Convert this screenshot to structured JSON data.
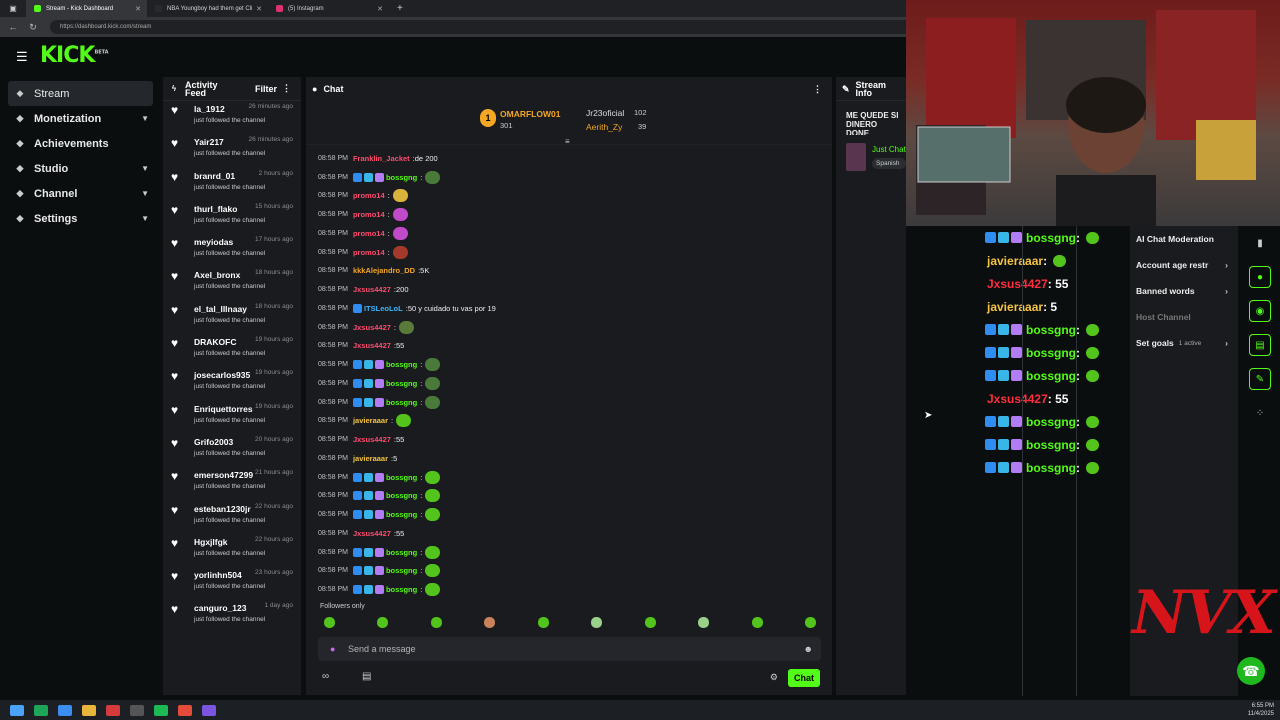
{
  "browser": {
    "tabs": [
      {
        "label": "Stream - Kick Dashboard",
        "color": "#53fc18"
      },
      {
        "label": "NBA Youngboy had them get Cli",
        "color": "#2a2a2a"
      },
      {
        "label": "(5) Instagram",
        "color": "#e1306c"
      }
    ],
    "url": "https://dashboard.kick.com/stream"
  },
  "brand": {
    "logo": "KICK",
    "beta": "BETA"
  },
  "sidebar": {
    "items": [
      {
        "label": "Stream",
        "icon": "stream-icon",
        "chev": ""
      },
      {
        "label": "Monetization",
        "icon": "dollar-icon",
        "chev": "▼"
      },
      {
        "label": "Achievements",
        "icon": "trophy-icon",
        "chev": ""
      },
      {
        "label": "Studio",
        "icon": "studio-icon",
        "chev": "▼"
      },
      {
        "label": "Channel",
        "icon": "channel-icon",
        "chev": "▼"
      },
      {
        "label": "Settings",
        "icon": "gear-icon",
        "chev": "▼"
      }
    ]
  },
  "activity": {
    "title": "Activity Feed",
    "filter": "Filter",
    "items": [
      {
        "name": "la_1912",
        "ago": "26 minutes ago",
        "text": "just followed the channel"
      },
      {
        "name": "Yair217",
        "ago": "26 minutes ago",
        "text": "just followed the channel"
      },
      {
        "name": "branrd_01",
        "ago": "2 hours ago",
        "text": "just followed the channel"
      },
      {
        "name": "thurl_flako",
        "ago": "15 hours ago",
        "text": "just followed the channel"
      },
      {
        "name": "meyiodas",
        "ago": "17 hours ago",
        "text": "just followed the channel"
      },
      {
        "name": "Axel_bronx",
        "ago": "18 hours ago",
        "text": "just followed the channel"
      },
      {
        "name": "el_tal_lllnaay",
        "ago": "18 hours ago",
        "text": "just followed the channel"
      },
      {
        "name": "DRAKOFC",
        "ago": "19 hours ago",
        "text": "just followed the channel"
      },
      {
        "name": "josecarlos935",
        "ago": "19 hours ago",
        "text": "just followed the channel"
      },
      {
        "name": "Enriquettorres",
        "ago": "19 hours ago",
        "text": "just followed the channel"
      },
      {
        "name": "Grifo2003",
        "ago": "20 hours ago",
        "text": "just followed the channel"
      },
      {
        "name": "emerson47299",
        "ago": "21 hours ago",
        "text": "just followed the channel"
      },
      {
        "name": "esteban1230jr",
        "ago": "22 hours ago",
        "text": "just followed the channel"
      },
      {
        "name": "Hgxjlfgk",
        "ago": "22 hours ago",
        "text": "just followed the channel"
      },
      {
        "name": "yorlinhn504",
        "ago": "23 hours ago",
        "text": "just followed the channel"
      },
      {
        "name": "canguro_123",
        "ago": "1 day ago",
        "text": "just followed the channel"
      }
    ]
  },
  "chat": {
    "title": "Chat",
    "top_user": "OMARFLOW01",
    "top_count": "301",
    "rank": "1",
    "second_user": "Jr23oficial",
    "second_count": "102",
    "third_user": "Aerith_Zy",
    "third_count": "39",
    "messages": [
      {
        "time": "08:58 PM",
        "user": "Franklin_Jacket",
        "color": "#ff4b6e",
        "text": "de 200",
        "badges": 0,
        "emote": ""
      },
      {
        "time": "08:58 PM",
        "user": "bossgng",
        "color": "#53fc18",
        "text": "",
        "badges": 3,
        "emote": "#4a7a3a"
      },
      {
        "time": "08:58 PM",
        "user": "promo14",
        "color": "#ff4b6e",
        "text": "",
        "badges": 0,
        "emote": "#d9b33c"
      },
      {
        "time": "08:58 PM",
        "user": "promo14",
        "color": "#ff4b6e",
        "text": "",
        "badges": 0,
        "emote": "#c04ac8"
      },
      {
        "time": "08:58 PM",
        "user": "promo14",
        "color": "#ff4b6e",
        "text": "",
        "badges": 0,
        "emote": "#c04ac8"
      },
      {
        "time": "08:58 PM",
        "user": "promo14",
        "color": "#ff4b6e",
        "text": "",
        "badges": 0,
        "emote": "#a53a2a"
      },
      {
        "time": "08:58 PM",
        "user": "kkkAlejandro_DD",
        "color": "#f5a623",
        "text": "5K",
        "badges": 0,
        "emote": ""
      },
      {
        "time": "08:58 PM",
        "user": "Jxsus4427",
        "color": "#ff4b6e",
        "text": "200",
        "badges": 0,
        "emote": ""
      },
      {
        "time": "08:58 PM",
        "user": "ITSLeoLoL",
        "color": "#3ab7ff",
        "text": "50 y cuidado tu vas por 19",
        "badges": 1,
        "emote": ""
      },
      {
        "time": "08:58 PM",
        "user": "Jxsus4427",
        "color": "#ff4b6e",
        "text": "",
        "badges": 0,
        "emote": "#5a7a3a"
      },
      {
        "time": "08:58 PM",
        "user": "Jxsus4427",
        "color": "#ff4b6e",
        "text": "55",
        "badges": 0,
        "emote": ""
      },
      {
        "time": "08:58 PM",
        "user": "bossgng",
        "color": "#53fc18",
        "text": "",
        "badges": 3,
        "emote": "#4a7a3a"
      },
      {
        "time": "08:58 PM",
        "user": "bossgng",
        "color": "#53fc18",
        "text": "",
        "badges": 3,
        "emote": "#4a7a3a"
      },
      {
        "time": "08:58 PM",
        "user": "bossgng",
        "color": "#53fc18",
        "text": "",
        "badges": 3,
        "emote": "#4a7a3a"
      },
      {
        "time": "08:58 PM",
        "user": "javieraaar",
        "color": "#f5c542",
        "text": "",
        "badges": 0,
        "emote": "#53c41b"
      },
      {
        "time": "08:58 PM",
        "user": "Jxsus4427",
        "color": "#ff4b6e",
        "text": "55",
        "badges": 0,
        "emote": ""
      },
      {
        "time": "08:58 PM",
        "user": "javieraaar",
        "color": "#f5c542",
        "text": "5",
        "badges": 0,
        "emote": ""
      },
      {
        "time": "08:58 PM",
        "user": "bossgng",
        "color": "#53fc18",
        "text": "",
        "badges": 3,
        "emote": "#53c41b"
      },
      {
        "time": "08:58 PM",
        "user": "bossgng",
        "color": "#53fc18",
        "text": "",
        "badges": 3,
        "emote": "#53c41b"
      },
      {
        "time": "08:58 PM",
        "user": "bossgng",
        "color": "#53fc18",
        "text": "",
        "badges": 3,
        "emote": "#53c41b"
      },
      {
        "time": "08:58 PM",
        "user": "Jxsus4427",
        "color": "#ff4b6e",
        "text": "55",
        "badges": 0,
        "emote": ""
      },
      {
        "time": "08:58 PM",
        "user": "bossgng",
        "color": "#53fc18",
        "text": "",
        "badges": 3,
        "emote": "#53c41b"
      },
      {
        "time": "08:58 PM",
        "user": "bossgng",
        "color": "#53fc18",
        "text": "",
        "badges": 3,
        "emote": "#53c41b"
      },
      {
        "time": "08:58 PM",
        "user": "bossgng",
        "color": "#53fc18",
        "text": "",
        "badges": 3,
        "emote": "#53c41b"
      }
    ],
    "followers_only": "Followers only",
    "placeholder": "Send a message",
    "send": "Chat"
  },
  "stream_info": {
    "title": "Stream Info",
    "stream_title": "ME QUEDE SI DINERO DONE",
    "category": "Just Chatting",
    "language": "Spanish"
  },
  "overlay": [
    {
      "user": "bossgng",
      "color": "#53fc18",
      "badges": 3,
      "text": "",
      "emote": true
    },
    {
      "user": "javieraaar",
      "color": "#f5c542",
      "badges": 0,
      "text": "",
      "emote": true
    },
    {
      "user": "Jxsus4427",
      "color": "#ff2d3d",
      "badges": 0,
      "text": "55",
      "emote": false
    },
    {
      "user": "javieraaar",
      "color": "#f5c542",
      "badges": 0,
      "text": "5",
      "emote": false
    },
    {
      "user": "bossgng",
      "color": "#53fc18",
      "badges": 3,
      "text": "",
      "emote": true
    },
    {
      "user": "bossgng",
      "color": "#53fc18",
      "badges": 3,
      "text": "",
      "emote": true
    },
    {
      "user": "bossgng",
      "color": "#53fc18",
      "badges": 3,
      "text": "",
      "emote": true
    },
    {
      "user": "Jxsus4427",
      "color": "#ff2d3d",
      "badges": 0,
      "text": "55",
      "emote": false
    },
    {
      "user": "bossgng",
      "color": "#53fc18",
      "badges": 3,
      "text": "",
      "emote": true
    },
    {
      "user": "bossgng",
      "color": "#53fc18",
      "badges": 3,
      "text": "",
      "emote": true
    },
    {
      "user": "bossgng",
      "color": "#53fc18",
      "badges": 3,
      "text": "",
      "emote": true
    }
  ],
  "mod": {
    "items": [
      {
        "label": "AI Chat Moderation",
        "chev": ""
      },
      {
        "label": "Account age restr",
        "chev": "›"
      },
      {
        "label": "Banned words",
        "chev": "›"
      },
      {
        "label": "Host Channel",
        "chev": ""
      },
      {
        "label": "Set goals",
        "extra": "1 active",
        "chev": "›"
      }
    ]
  },
  "watermark": "NVX",
  "clock": {
    "time": "6:55 PM",
    "date": "11/4/2025"
  }
}
